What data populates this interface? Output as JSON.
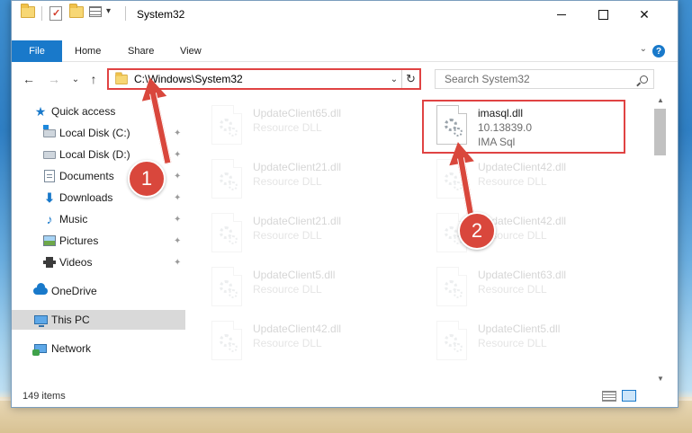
{
  "window": {
    "title": "System32",
    "min_glyph": "",
    "max_glyph": "",
    "close_glyph": "✕"
  },
  "ribbon": {
    "tabs": [
      "File",
      "Home",
      "Share",
      "View"
    ]
  },
  "navigation": {
    "back_glyph": "←",
    "forward_glyph": "→",
    "recent_glyph": "⌄",
    "up_glyph": "↑",
    "address": "C:\\Windows\\System32",
    "refresh_glyph": "↻",
    "dropdown_glyph": "⌄",
    "search_placeholder": "Search System32"
  },
  "sidebar": {
    "items": [
      {
        "label": "Quick access",
        "icon": "star-icon",
        "pinned": false
      },
      {
        "label": "Local Disk (C:)",
        "icon": "disk-icon",
        "pinned": true
      },
      {
        "label": "Local Disk (D:)",
        "icon": "disk-icon",
        "pinned": true
      },
      {
        "label": "Documents",
        "icon": "documents-icon",
        "pinned": true
      },
      {
        "label": "Downloads",
        "icon": "downloads-icon",
        "pinned": true
      },
      {
        "label": "Music",
        "icon": "music-icon",
        "pinned": true
      },
      {
        "label": "Pictures",
        "icon": "pictures-icon",
        "pinned": true
      },
      {
        "label": "Videos",
        "icon": "videos-icon",
        "pinned": true
      },
      {
        "label": "OneDrive",
        "icon": "onedrive-icon",
        "pinned": false
      },
      {
        "label": "This PC",
        "icon": "this-pc-icon",
        "pinned": false,
        "selected": true
      },
      {
        "label": "Network",
        "icon": "network-icon",
        "pinned": false
      }
    ],
    "pin_glyph": "📌"
  },
  "files": [
    {
      "name": "UpdateClient65.dll",
      "sub1": "Resource DLL",
      "faded": true
    },
    {
      "name": "imasql.dll",
      "sub1": "10.13839.0",
      "sub2": "IMA Sql",
      "faded": false,
      "highlighted": true
    },
    {
      "name": "UpdateClient21.dll",
      "sub1": "Resource DLL",
      "faded": true
    },
    {
      "name": "UpdateClient42.dll",
      "sub1": "Resource DLL",
      "faded": true
    },
    {
      "name": "UpdateClient21.dll",
      "sub1": "Resource DLL",
      "faded": true
    },
    {
      "name": "UpdateClient42.dll",
      "sub1": "Resource DLL",
      "faded": true
    },
    {
      "name": "UpdateClient5.dll",
      "sub1": "Resource DLL",
      "faded": true
    },
    {
      "name": "UpdateClient63.dll",
      "sub1": "Resource DLL",
      "faded": true
    },
    {
      "name": "UpdateClient42.dll",
      "sub1": "Resource DLL",
      "faded": true
    },
    {
      "name": "UpdateClient5.dll",
      "sub1": "Resource DLL",
      "faded": true
    }
  ],
  "status": {
    "item_count": "149 items"
  },
  "annotations": [
    {
      "number": "1"
    },
    {
      "number": "2"
    }
  ],
  "colors": {
    "accent": "#1979ca",
    "highlight_red": "#e04343",
    "marker_red": "#d9473c"
  }
}
